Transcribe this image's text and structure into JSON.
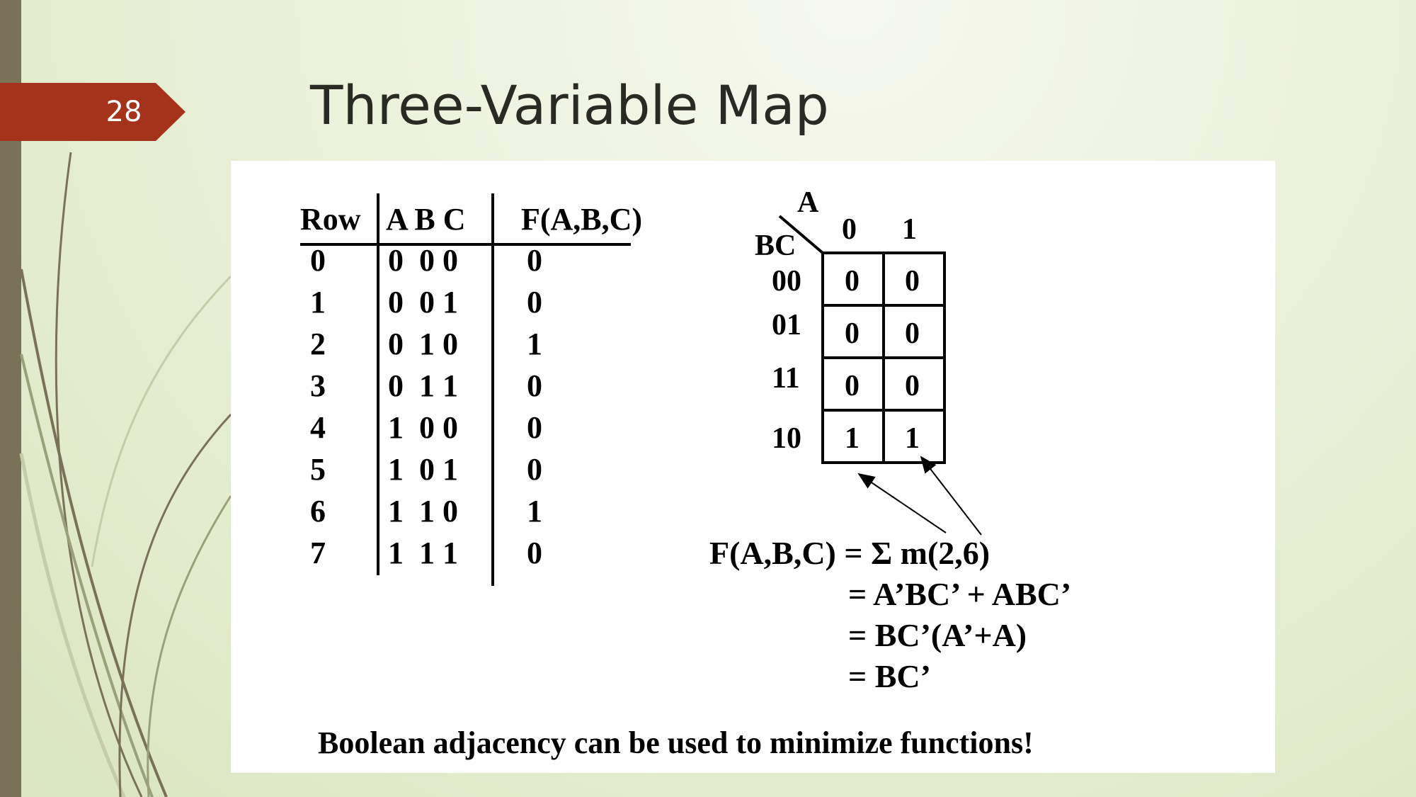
{
  "slide": {
    "number": "28",
    "title": "Three-Variable Map"
  },
  "truth_table": {
    "headers": [
      "Row",
      "A B C",
      "F(A,B,C)"
    ],
    "rows": [
      [
        "0",
        "0  0 0",
        "0"
      ],
      [
        "1",
        "0  0 1",
        "0"
      ],
      [
        "2",
        "0  1 0",
        "1"
      ],
      [
        "3",
        "0  1 1",
        "0"
      ],
      [
        "4",
        "1  0 0",
        "0"
      ],
      [
        "5",
        "1  0 1",
        "0"
      ],
      [
        "6",
        "1  1 0",
        "1"
      ],
      [
        "7",
        "1  1 1",
        "0"
      ]
    ]
  },
  "kmap": {
    "col_var": "A",
    "row_var": "BC",
    "col_labels": [
      "0",
      "1"
    ],
    "row_labels": [
      "00",
      "01",
      "11",
      "10"
    ],
    "cells": [
      [
        "0",
        "0"
      ],
      [
        "0",
        "0"
      ],
      [
        "0",
        "0"
      ],
      [
        "1",
        "1"
      ]
    ]
  },
  "equations": [
    "F(A,B,C) = Σ m(2,6)",
    "= A’BC’ + ABC’",
    "= BC’(A’+A)",
    "= BC’"
  ],
  "footer": "Boolean adjacency can be used to minimize functions!",
  "colors": {
    "badge": "#a5321a",
    "left_bar": "#7a7258",
    "deco_lines": "#7a7258"
  }
}
